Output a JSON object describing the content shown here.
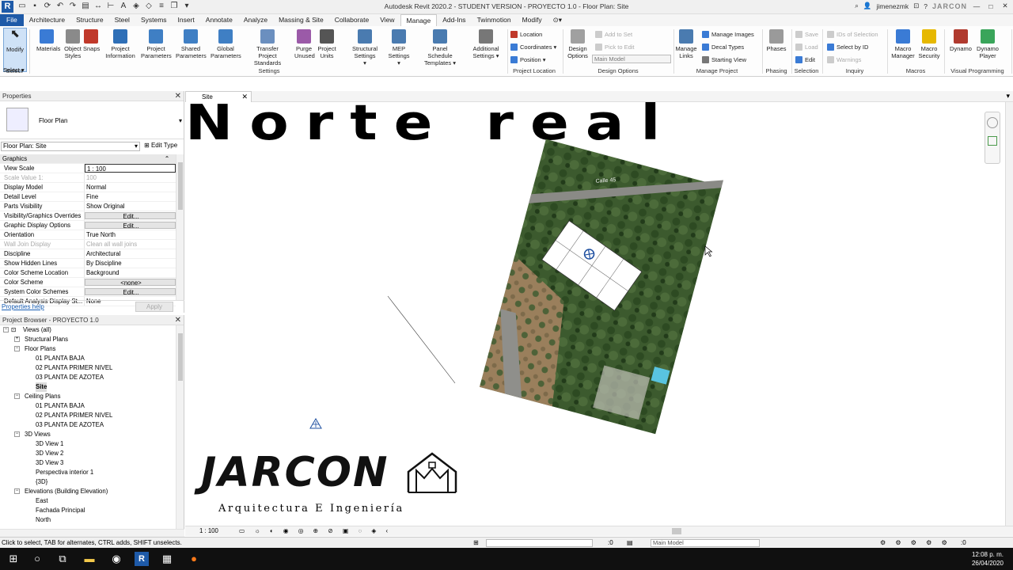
{
  "title_bar": {
    "title": "Autodesk Revit 2020.2 - STUDENT VERSION - PROYECTO 1.0 - Floor Plan: Site",
    "user": "jimenezmk",
    "brand": "JARCON"
  },
  "tabs": [
    "File",
    "Architecture",
    "Structure",
    "Steel",
    "Systems",
    "Insert",
    "Annotate",
    "Analyze",
    "Massing & Site",
    "Collaborate",
    "View",
    "Manage",
    "Add-Ins",
    "Twinmotion",
    "Modify"
  ],
  "active_tab": "Manage",
  "ribbon": {
    "modify": {
      "line1": "Modify",
      "line2": ""
    },
    "select_label": "Select ▾",
    "buttons": [
      {
        "line1": "Materials",
        "line2": ""
      },
      {
        "line1": "Object",
        "line2": "Styles"
      },
      {
        "line1": "Snaps",
        "line2": ""
      },
      {
        "line1": "Project",
        "line2": "Information"
      },
      {
        "line1": "Project",
        "line2": "Parameters"
      },
      {
        "line1": "Shared",
        "line2": "Parameters"
      },
      {
        "line1": "Global",
        "line2": "Parameters"
      },
      {
        "line1": "Transfer",
        "line2": "Project Standards"
      },
      {
        "line1": "Purge",
        "line2": "Unused"
      },
      {
        "line1": "Project",
        "line2": "Units"
      },
      {
        "line1": "Structural",
        "line2": "Settings ▾"
      },
      {
        "line1": "MEP",
        "line2": "Settings ▾"
      },
      {
        "line1": "Panel Schedule",
        "line2": "Templates ▾"
      },
      {
        "line1": "Additional",
        "line2": "Settings ▾"
      }
    ],
    "location_items": [
      "Location",
      "Coordinates ▾",
      "Position ▾"
    ],
    "design_options": {
      "line1": "Design",
      "line2": "Options",
      "add": "Add to Set",
      "pick": "Pick to Edit",
      "main_model": "Main Model"
    },
    "manage_links": {
      "line1": "Manage",
      "line2": "Links",
      "items": [
        "Manage  Images",
        "Decal  Types",
        "Starting  View"
      ]
    },
    "phases": {
      "line1": "Phases",
      "line2": ""
    },
    "selection_items": [
      "Save",
      "Load",
      "Edit"
    ],
    "inquiry_items": [
      "IDs of  Selection",
      "Select  by ID",
      "Warnings"
    ],
    "macros": [
      {
        "line1": "Macro",
        "line2": "Manager"
      },
      {
        "line1": "Macro",
        "line2": "Security"
      }
    ],
    "visual_programming": [
      {
        "line1": "Dynamo",
        "line2": ""
      },
      {
        "line1": "Dynamo",
        "line2": "Player"
      }
    ],
    "group_labels": {
      "select": "Select",
      "settings": "Settings",
      "project_location": "Project Location",
      "design_options": "Design Options",
      "manage_project": "Manage Project",
      "phasing": "Phasing",
      "selection": "Selection",
      "inquiry": "Inquiry",
      "macros": "Macros",
      "visual_programming": "Visual Programming"
    }
  },
  "properties": {
    "header": "Properties",
    "type_name": "Floor Plan",
    "filter": "Floor Plan: Site",
    "edit_type": "Edit Type",
    "category": "Graphics",
    "rows": [
      {
        "k": "View Scale",
        "v": "1 : 100",
        "style": "box"
      },
      {
        "k": "Scale Value    1:",
        "v": "100",
        "style": "dis"
      },
      {
        "k": "Display Model",
        "v": "Normal",
        "style": ""
      },
      {
        "k": "Detail Level",
        "v": "Fine",
        "style": ""
      },
      {
        "k": "Parts Visibility",
        "v": "Show Original",
        "style": ""
      },
      {
        "k": "Visibility/Graphics Overrides",
        "v": "Edit...",
        "style": "btn"
      },
      {
        "k": "Graphic Display Options",
        "v": "Edit...",
        "style": "btn"
      },
      {
        "k": "Orientation",
        "v": "True North",
        "style": ""
      },
      {
        "k": "Wall Join Display",
        "v": "Clean all wall joins",
        "style": "dis"
      },
      {
        "k": "Discipline",
        "v": "Architectural",
        "style": ""
      },
      {
        "k": "Show Hidden Lines",
        "v": "By Discipline",
        "style": ""
      },
      {
        "k": "Color Scheme Location",
        "v": "Background",
        "style": ""
      },
      {
        "k": "Color Scheme",
        "v": "<none>",
        "style": "btn"
      },
      {
        "k": "System Color Schemes",
        "v": "Edit...",
        "style": "btn"
      },
      {
        "k": "Default Analysis Display St...",
        "v": "None",
        "style": ""
      }
    ],
    "help": "Properties help",
    "apply": "Apply"
  },
  "browser": {
    "header": "Project Browser - PROYECTO 1.0",
    "nodes": [
      {
        "label": "Views (all)",
        "level": 0,
        "exp": "−"
      },
      {
        "label": "Structural Plans",
        "level": 1,
        "exp": "+"
      },
      {
        "label": "Floor Plans",
        "level": 1,
        "exp": "−"
      },
      {
        "label": "01 PLANTA BAJA",
        "level": 2,
        "exp": ""
      },
      {
        "label": "02 PLANTA PRIMER NIVEL",
        "level": 2,
        "exp": ""
      },
      {
        "label": "03 PLANTA DE AZOTEA",
        "level": 2,
        "exp": ""
      },
      {
        "label": "Site",
        "level": 2,
        "exp": "",
        "selected": true
      },
      {
        "label": "Ceiling Plans",
        "level": 1,
        "exp": "−"
      },
      {
        "label": "01 PLANTA BAJA",
        "level": 2,
        "exp": ""
      },
      {
        "label": "02 PLANTA PRIMER NIVEL",
        "level": 2,
        "exp": ""
      },
      {
        "label": "03 PLANTA DE AZOTEA",
        "level": 2,
        "exp": ""
      },
      {
        "label": "3D Views",
        "level": 1,
        "exp": "−"
      },
      {
        "label": "3D View 1",
        "level": 2,
        "exp": ""
      },
      {
        "label": "3D View 2",
        "level": 2,
        "exp": ""
      },
      {
        "label": "3D View 3",
        "level": 2,
        "exp": ""
      },
      {
        "label": "Perspectiva interior 1",
        "level": 2,
        "exp": ""
      },
      {
        "label": "{3D}",
        "level": 2,
        "exp": ""
      },
      {
        "label": "Elevations (Building Elevation)",
        "level": 1,
        "exp": "−"
      },
      {
        "label": "East",
        "level": 2,
        "exp": ""
      },
      {
        "label": "Fachada Principal",
        "level": 2,
        "exp": ""
      },
      {
        "label": "North",
        "level": 2,
        "exp": ""
      }
    ]
  },
  "view": {
    "tab_label": "Site",
    "overlay_title": "Norte real",
    "scale": "1 : 100",
    "logo_word": "JARCON",
    "logo_sub": "Arquitectura E Ingeniería",
    "street_label": "Calle 45"
  },
  "status": {
    "message": "Click to select, TAB for alternates, CTRL adds, SHIFT unselects.",
    "zero": ":0",
    "main_model": "Main Model",
    "filter": ":0"
  },
  "taskbar": {
    "time": "12:08 p. m.",
    "date": "26/04/2020"
  },
  "colors": {
    "accent": "#1e5aa8",
    "ribbon_active": "#cfe2f7",
    "aerial_green": "#3c5a2e",
    "aerial_soil": "#9a7f5c"
  }
}
